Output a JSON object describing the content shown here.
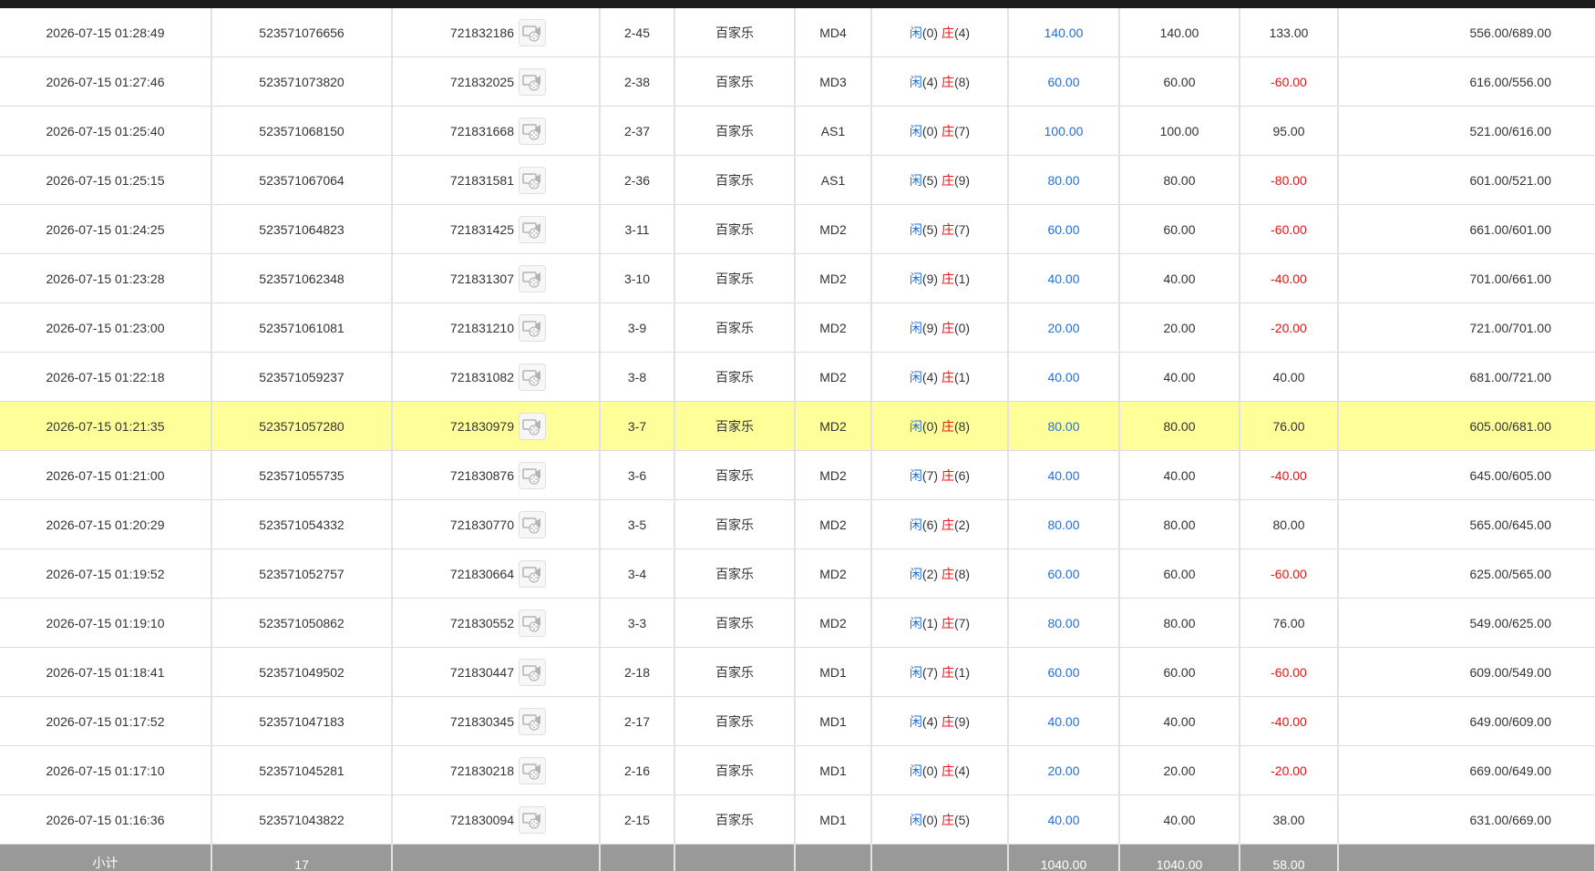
{
  "colors": {
    "header_bar": "#1c1c1c",
    "highlight_row": "#ffff99",
    "subtotal_bg": "#999999",
    "player_blue": "#1f6fe0",
    "banker_red": "#ee1111"
  },
  "icons": {
    "video": "video-replay-icon"
  },
  "rows": [
    {
      "time": "2026-07-15 01:28:49",
      "order_id": "523571076656",
      "round_id": "721832186",
      "shoe": "2-45",
      "game": "百家乐",
      "table": "MD4",
      "player_label": "闲",
      "player_score": "(0)",
      "banker_label": "庄",
      "banker_score": "(4)",
      "bet": "140.00",
      "valid_bet": "140.00",
      "win_loss": "133.00",
      "win_loss_negative": false,
      "balance": "556.00/689.00",
      "highlight": false
    },
    {
      "time": "2026-07-15 01:27:46",
      "order_id": "523571073820",
      "round_id": "721832025",
      "shoe": "2-38",
      "game": "百家乐",
      "table": "MD3",
      "player_label": "闲",
      "player_score": "(4)",
      "banker_label": "庄",
      "banker_score": "(8)",
      "bet": "60.00",
      "valid_bet": "60.00",
      "win_loss": "-60.00",
      "win_loss_negative": true,
      "balance": "616.00/556.00",
      "highlight": false
    },
    {
      "time": "2026-07-15 01:25:40",
      "order_id": "523571068150",
      "round_id": "721831668",
      "shoe": "2-37",
      "game": "百家乐",
      "table": "AS1",
      "player_label": "闲",
      "player_score": "(0)",
      "banker_label": "庄",
      "banker_score": "(7)",
      "bet": "100.00",
      "valid_bet": "100.00",
      "win_loss": "95.00",
      "win_loss_negative": false,
      "balance": "521.00/616.00",
      "highlight": false
    },
    {
      "time": "2026-07-15 01:25:15",
      "order_id": "523571067064",
      "round_id": "721831581",
      "shoe": "2-36",
      "game": "百家乐",
      "table": "AS1",
      "player_label": "闲",
      "player_score": "(5)",
      "banker_label": "庄",
      "banker_score": "(9)",
      "bet": "80.00",
      "valid_bet": "80.00",
      "win_loss": "-80.00",
      "win_loss_negative": true,
      "balance": "601.00/521.00",
      "highlight": false
    },
    {
      "time": "2026-07-15 01:24:25",
      "order_id": "523571064823",
      "round_id": "721831425",
      "shoe": "3-11",
      "game": "百家乐",
      "table": "MD2",
      "player_label": "闲",
      "player_score": "(5)",
      "banker_label": "庄",
      "banker_score": "(7)",
      "bet": "60.00",
      "valid_bet": "60.00",
      "win_loss": "-60.00",
      "win_loss_negative": true,
      "balance": "661.00/601.00",
      "highlight": false
    },
    {
      "time": "2026-07-15 01:23:28",
      "order_id": "523571062348",
      "round_id": "721831307",
      "shoe": "3-10",
      "game": "百家乐",
      "table": "MD2",
      "player_label": "闲",
      "player_score": "(9)",
      "banker_label": "庄",
      "banker_score": "(1)",
      "bet": "40.00",
      "valid_bet": "40.00",
      "win_loss": "-40.00",
      "win_loss_negative": true,
      "balance": "701.00/661.00",
      "highlight": false
    },
    {
      "time": "2026-07-15 01:23:00",
      "order_id": "523571061081",
      "round_id": "721831210",
      "shoe": "3-9",
      "game": "百家乐",
      "table": "MD2",
      "player_label": "闲",
      "player_score": "(9)",
      "banker_label": "庄",
      "banker_score": "(0)",
      "bet": "20.00",
      "valid_bet": "20.00",
      "win_loss": "-20.00",
      "win_loss_negative": true,
      "balance": "721.00/701.00",
      "highlight": false
    },
    {
      "time": "2026-07-15 01:22:18",
      "order_id": "523571059237",
      "round_id": "721831082",
      "shoe": "3-8",
      "game": "百家乐",
      "table": "MD2",
      "player_label": "闲",
      "player_score": "(4)",
      "banker_label": "庄",
      "banker_score": "(1)",
      "bet": "40.00",
      "valid_bet": "40.00",
      "win_loss": "40.00",
      "win_loss_negative": false,
      "balance": "681.00/721.00",
      "highlight": false
    },
    {
      "time": "2026-07-15 01:21:35",
      "order_id": "523571057280",
      "round_id": "721830979",
      "shoe": "3-7",
      "game": "百家乐",
      "table": "MD2",
      "player_label": "闲",
      "player_score": "(0)",
      "banker_label": "庄",
      "banker_score": "(8)",
      "bet": "80.00",
      "valid_bet": "80.00",
      "win_loss": "76.00",
      "win_loss_negative": false,
      "balance": "605.00/681.00",
      "highlight": true
    },
    {
      "time": "2026-07-15 01:21:00",
      "order_id": "523571055735",
      "round_id": "721830876",
      "shoe": "3-6",
      "game": "百家乐",
      "table": "MD2",
      "player_label": "闲",
      "player_score": "(7)",
      "banker_label": "庄",
      "banker_score": "(6)",
      "bet": "40.00",
      "valid_bet": "40.00",
      "win_loss": "-40.00",
      "win_loss_negative": true,
      "balance": "645.00/605.00",
      "highlight": false
    },
    {
      "time": "2026-07-15 01:20:29",
      "order_id": "523571054332",
      "round_id": "721830770",
      "shoe": "3-5",
      "game": "百家乐",
      "table": "MD2",
      "player_label": "闲",
      "player_score": "(6)",
      "banker_label": "庄",
      "banker_score": "(2)",
      "bet": "80.00",
      "valid_bet": "80.00",
      "win_loss": "80.00",
      "win_loss_negative": false,
      "balance": "565.00/645.00",
      "highlight": false
    },
    {
      "time": "2026-07-15 01:19:52",
      "order_id": "523571052757",
      "round_id": "721830664",
      "shoe": "3-4",
      "game": "百家乐",
      "table": "MD2",
      "player_label": "闲",
      "player_score": "(2)",
      "banker_label": "庄",
      "banker_score": "(8)",
      "bet": "60.00",
      "valid_bet": "60.00",
      "win_loss": "-60.00",
      "win_loss_negative": true,
      "balance": "625.00/565.00",
      "highlight": false
    },
    {
      "time": "2026-07-15 01:19:10",
      "order_id": "523571050862",
      "round_id": "721830552",
      "shoe": "3-3",
      "game": "百家乐",
      "table": "MD2",
      "player_label": "闲",
      "player_score": "(1)",
      "banker_label": "庄",
      "banker_score": "(7)",
      "bet": "80.00",
      "valid_bet": "80.00",
      "win_loss": "76.00",
      "win_loss_negative": false,
      "balance": "549.00/625.00",
      "highlight": false
    },
    {
      "time": "2026-07-15 01:18:41",
      "order_id": "523571049502",
      "round_id": "721830447",
      "shoe": "2-18",
      "game": "百家乐",
      "table": "MD1",
      "player_label": "闲",
      "player_score": "(7)",
      "banker_label": "庄",
      "banker_score": "(1)",
      "bet": "60.00",
      "valid_bet": "60.00",
      "win_loss": "-60.00",
      "win_loss_negative": true,
      "balance": "609.00/549.00",
      "highlight": false
    },
    {
      "time": "2026-07-15 01:17:52",
      "order_id": "523571047183",
      "round_id": "721830345",
      "shoe": "2-17",
      "game": "百家乐",
      "table": "MD1",
      "player_label": "闲",
      "player_score": "(4)",
      "banker_label": "庄",
      "banker_score": "(9)",
      "bet": "40.00",
      "valid_bet": "40.00",
      "win_loss": "-40.00",
      "win_loss_negative": true,
      "balance": "649.00/609.00",
      "highlight": false
    },
    {
      "time": "2026-07-15 01:17:10",
      "order_id": "523571045281",
      "round_id": "721830218",
      "shoe": "2-16",
      "game": "百家乐",
      "table": "MD1",
      "player_label": "闲",
      "player_score": "(0)",
      "banker_label": "庄",
      "banker_score": "(4)",
      "bet": "20.00",
      "valid_bet": "20.00",
      "win_loss": "-20.00",
      "win_loss_negative": true,
      "balance": "669.00/649.00",
      "highlight": false
    },
    {
      "time": "2026-07-15 01:16:36",
      "order_id": "523571043822",
      "round_id": "721830094",
      "shoe": "2-15",
      "game": "百家乐",
      "table": "MD1",
      "player_label": "闲",
      "player_score": "(0)",
      "banker_label": "庄",
      "banker_score": "(5)",
      "bet": "40.00",
      "valid_bet": "40.00",
      "win_loss": "38.00",
      "win_loss_negative": false,
      "balance": "631.00/669.00",
      "highlight": false
    }
  ],
  "subtotal": {
    "label": "小计",
    "count": "17",
    "bet": "1040.00",
    "valid_bet": "1040.00",
    "win_loss": "58.00"
  }
}
